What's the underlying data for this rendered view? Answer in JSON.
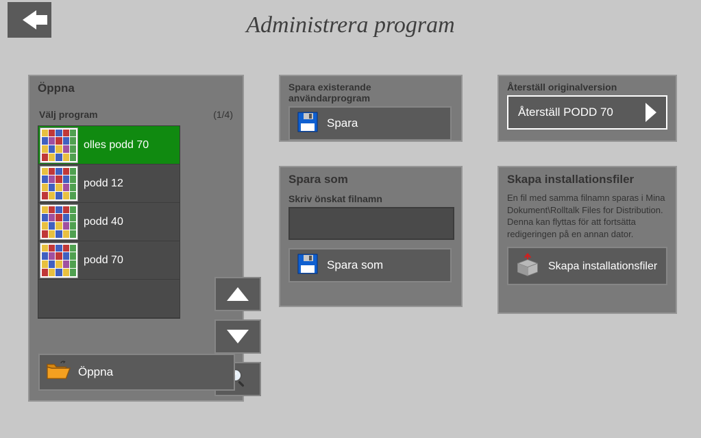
{
  "header": {
    "title": "Administrera program"
  },
  "open": {
    "title": "Öppna",
    "choose_label": "Välj program",
    "page_indicator": "(1/4)",
    "items": [
      {
        "label": "olles podd 70",
        "selected": true
      },
      {
        "label": "podd 12",
        "selected": false
      },
      {
        "label": "podd 40",
        "selected": false
      },
      {
        "label": "podd 70",
        "selected": false
      }
    ],
    "open_button": "Öppna"
  },
  "save_existing": {
    "title": "Spara existerande användarprogram",
    "button": "Spara"
  },
  "save_as": {
    "title": "Spara som",
    "filename_label": "Skriv önskat filnamn",
    "filename_value": "",
    "button": "Spara som"
  },
  "restore": {
    "title": "Återställ originalversion",
    "button": "Återställ PODD 70"
  },
  "installer": {
    "title": "Skapa installationsfiler",
    "description": "En fil med samma filnamn sparas i Mina Dokument\\Rolltalk Files for Distribution. Denna kan flyttas för att fortsätta redigeringen på en annan dator.",
    "button": "Skapa installationsfiler"
  }
}
